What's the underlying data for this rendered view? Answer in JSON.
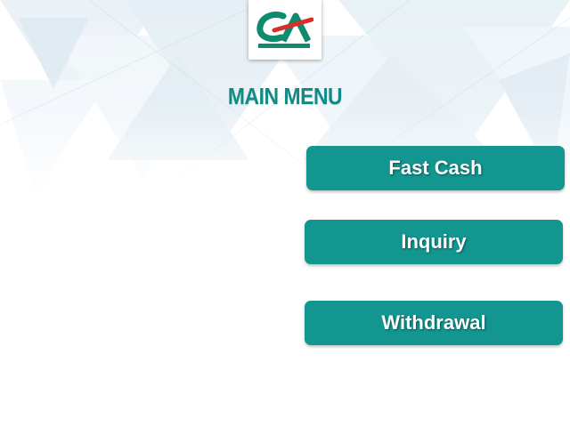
{
  "bank": {
    "logo_text": "CA",
    "logo_colors": {
      "green": "#0e8a6c",
      "red": "#d92d2a"
    }
  },
  "screen": {
    "title": "MAIN MENU",
    "accent_color": "#139590"
  },
  "menu": {
    "fast_cash": "Fast Cash",
    "inquiry": "Inquiry",
    "withdrawal": "Withdrawal"
  }
}
